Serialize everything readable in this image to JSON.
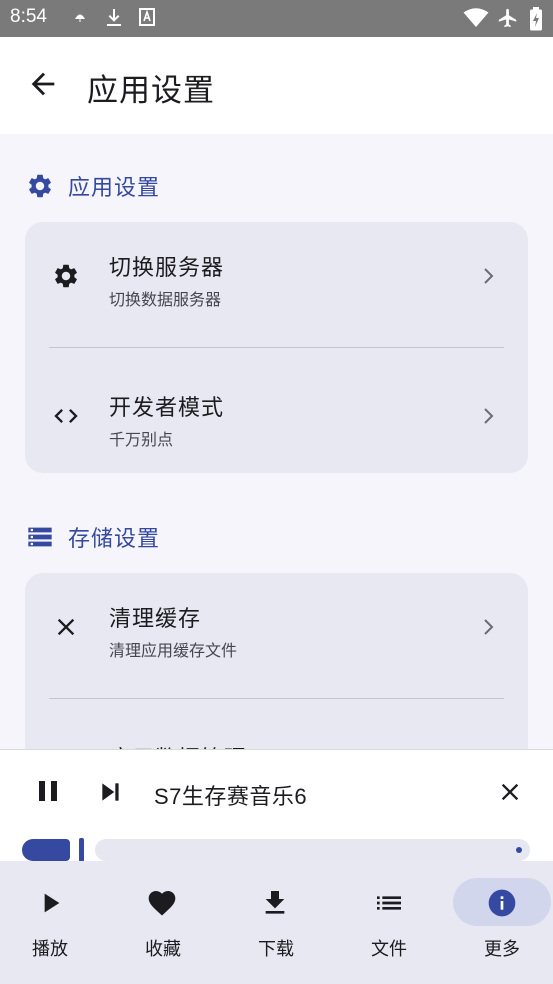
{
  "status_bar": {
    "time": "8:54"
  },
  "app_bar": {
    "title": "应用设置"
  },
  "sections": [
    {
      "title": "应用设置",
      "items": [
        {
          "title": "切换服务器",
          "subtitle": "切换数据服务器"
        },
        {
          "title": "开发者模式",
          "subtitle": "千万别点"
        }
      ]
    },
    {
      "title": "存储设置",
      "items": [
        {
          "title": "清理缓存",
          "subtitle": "清理应用缓存文件"
        },
        {
          "title": "应用数据管理",
          "subtitle": ""
        }
      ]
    }
  ],
  "player": {
    "song_title": "S7生存赛音乐6",
    "progress_fraction": 0.12
  },
  "bottom_nav": {
    "items": [
      {
        "label": "播放",
        "icon": "play-icon"
      },
      {
        "label": "收藏",
        "icon": "heart-icon"
      },
      {
        "label": "下载",
        "icon": "download-icon"
      },
      {
        "label": "文件",
        "icon": "list-icon"
      },
      {
        "label": "更多",
        "icon": "info-icon"
      }
    ],
    "active": "更多"
  },
  "colors": {
    "accent": "#3549a0",
    "card": "#e7e8f1",
    "background": "#f5f5fb"
  }
}
